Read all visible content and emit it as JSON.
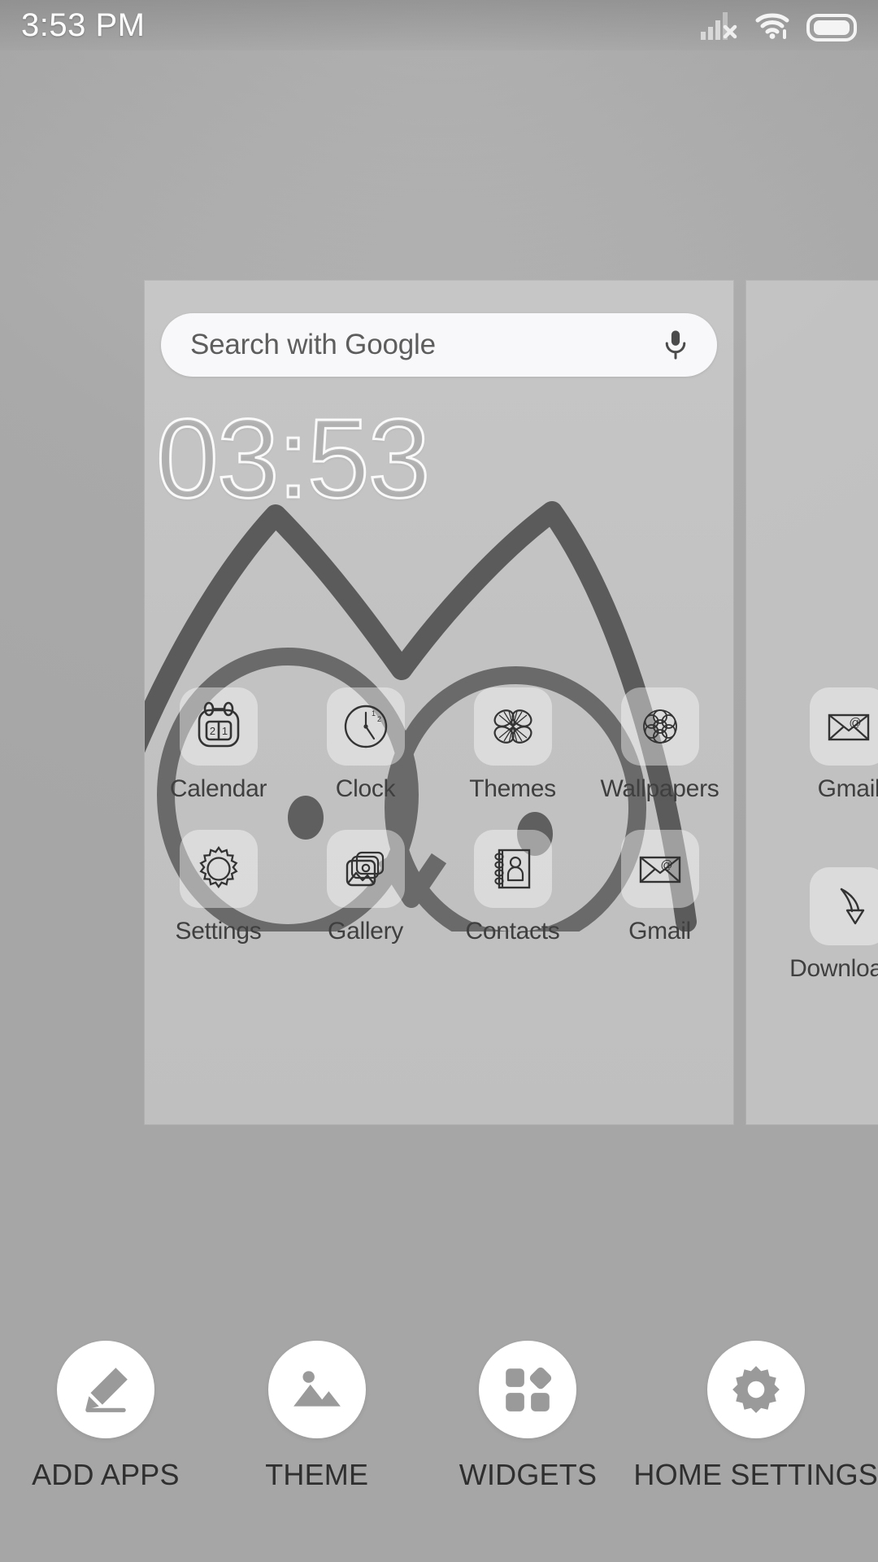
{
  "status_bar": {
    "time": "3:53 PM",
    "icons": [
      "signal-no-sim-icon",
      "wifi-icon",
      "battery-full-icon"
    ]
  },
  "home_screen": {
    "search_widget": {
      "placeholder": "Search with Google",
      "mic_icon": "microphone-icon"
    },
    "clock_widget": {
      "time": "03:53"
    },
    "wallpaper": {
      "name": "owl-line-art-wallpaper"
    },
    "current_page": {
      "rows": [
        [
          {
            "label": "Calendar",
            "icon": "calendar-icon"
          },
          {
            "label": "Clock",
            "icon": "clock-icon"
          },
          {
            "label": "Themes",
            "icon": "themes-flower-icon"
          },
          {
            "label": "Wallpapers",
            "icon": "wallpapers-rosette-icon"
          }
        ],
        [
          {
            "label": "Settings",
            "icon": "gear-icon"
          },
          {
            "label": "Gallery",
            "icon": "photos-icon"
          },
          {
            "label": "Contacts",
            "icon": "contacts-book-icon"
          },
          {
            "label": "Gmail",
            "icon": "envelope-at-icon"
          }
        ]
      ]
    },
    "next_page": {
      "items": [
        {
          "label": "Gmail",
          "icon": "envelope-at-icon"
        },
        {
          "label": "Downloads",
          "icon": "download-arrow-icon"
        }
      ]
    }
  },
  "edit_toolbar": {
    "items": [
      {
        "label": "ADD APPS",
        "icon": "pencil-icon"
      },
      {
        "label": "THEME",
        "icon": "image-icon"
      },
      {
        "label": "WIDGETS",
        "icon": "widgets-icon"
      },
      {
        "label": "HOME SETTINGS",
        "icon": "gear-icon"
      }
    ]
  },
  "colors": {
    "background": "#adadad",
    "page_card": "#d0d0d0",
    "search_pill": "#f8f7f9",
    "toolbar_circle": "#ffffff",
    "label_text": "#2f2f2f",
    "icon_line": "#333333"
  }
}
